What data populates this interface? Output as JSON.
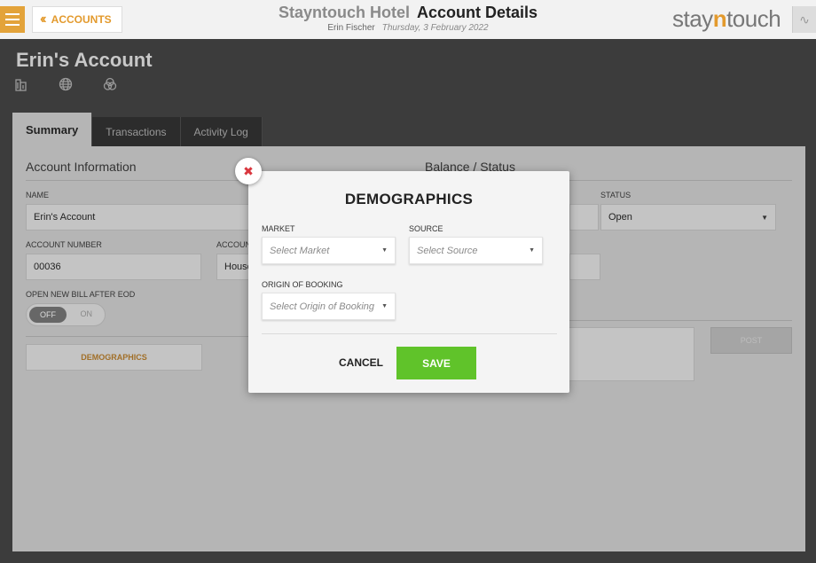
{
  "header": {
    "back_label": "ACCOUNTS",
    "hotel_name": "Stayntouch Hotel",
    "page_title": "Account Details",
    "user_name": "Erin Fischer",
    "date": "Thursday, 3 February 2022",
    "logo_prefix": "stay",
    "logo_accent": "n",
    "logo_suffix": "touch"
  },
  "account": {
    "title": "Erin's Account"
  },
  "tabs": [
    {
      "label": "Summary"
    },
    {
      "label": "Transactions"
    },
    {
      "label": "Activity Log"
    }
  ],
  "account_info": {
    "section_title": "Account Information",
    "name_label": "NAME",
    "name_value": "Erin's Account",
    "account_number_label": "ACCOUNT NUMBER",
    "account_number_value": "00036",
    "account_type_label": "ACCOUN",
    "account_type_value": "House",
    "open_new_bill_label": "OPEN NEW BILL AFTER EOD",
    "toggle_off": "OFF",
    "toggle_on": "ON",
    "demographics_button": "DEMOGRAPHICS"
  },
  "balance_status": {
    "section_title": "Balance / Status",
    "status_label": "STATUS",
    "status_value": "Open",
    "post_button": "POST"
  },
  "modal": {
    "title": "DEMOGRAPHICS",
    "market_label": "MARKET",
    "market_placeholder": "Select Market",
    "source_label": "SOURCE",
    "source_placeholder": "Select Source",
    "origin_label": "ORIGIN OF BOOKING",
    "origin_placeholder": "Select Origin of Booking",
    "cancel_label": "CANCEL",
    "save_label": "SAVE"
  },
  "colors": {
    "accent": "#e39a2d",
    "save_green": "#60c32a",
    "close_red": "#d9363e"
  }
}
